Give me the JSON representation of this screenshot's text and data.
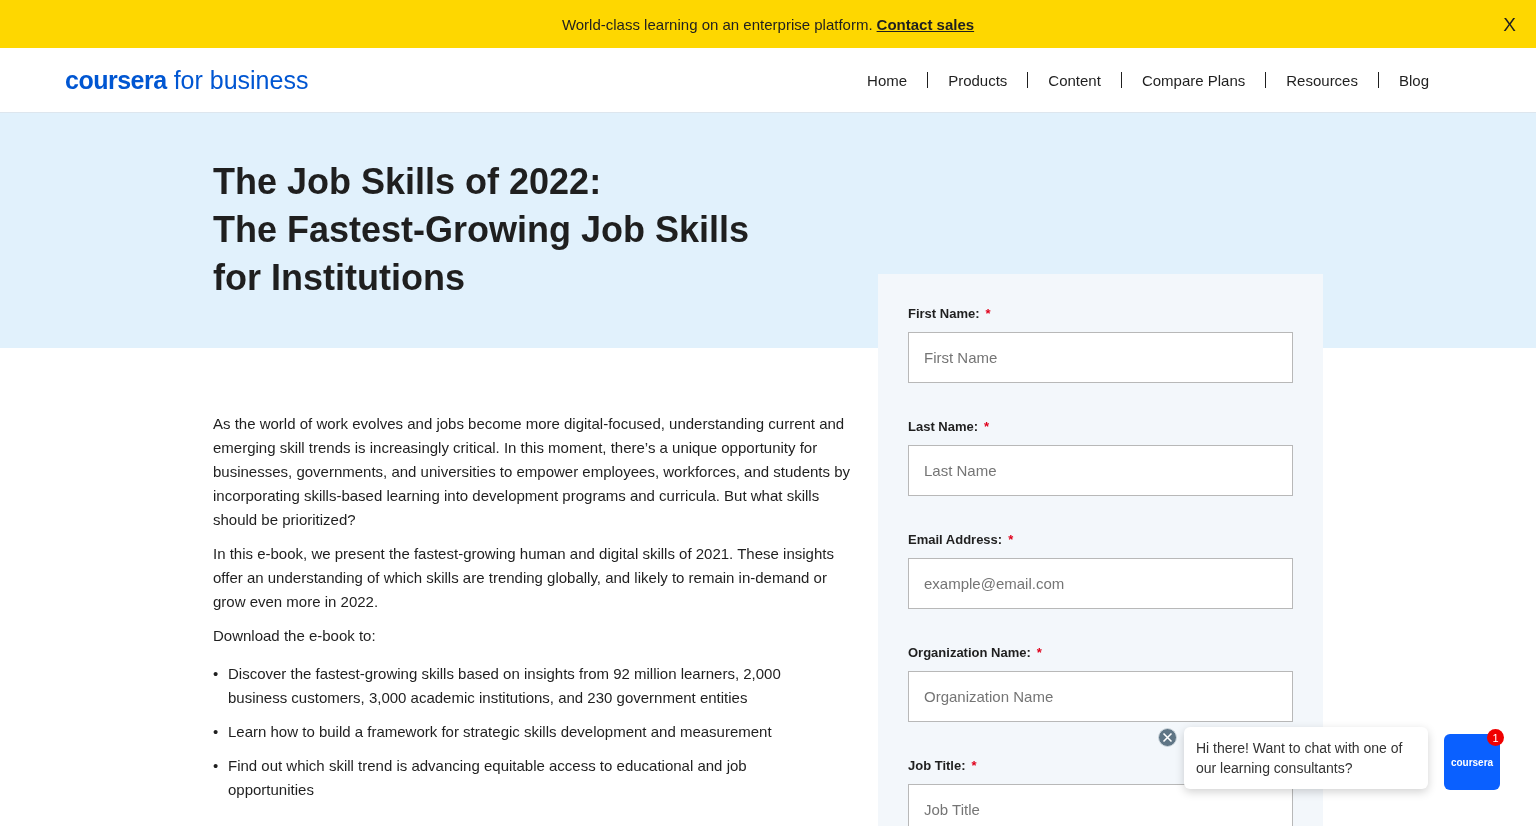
{
  "banner": {
    "text": "World-class learning on an enterprise platform.",
    "link": "Contact sales",
    "close": "X"
  },
  "header": {
    "logo": {
      "brand": "coursera",
      "suffix": "for business"
    },
    "nav": [
      {
        "label": "Home"
      },
      {
        "label": "Products"
      },
      {
        "label": "Content"
      },
      {
        "label": "Compare Plans"
      },
      {
        "label": "Resources"
      },
      {
        "label": "Blog"
      }
    ]
  },
  "hero": {
    "title_lines": [
      "The Job Skills of 2022:",
      "The Fastest-Growing Job Skills for Institutions"
    ]
  },
  "article": {
    "paragraphs": [
      "As the world of work evolves and jobs become more digital-focused, understanding current and emerging skill trends is increasingly critical. In this moment, there’s a unique opportunity for businesses, governments, and universities to empower employees, workforces, and students by incorporating skills-based learning into development programs and curricula. But what skills should be prioritized?",
      "In this e-book, we present the fastest-growing human and digital skills of 2021. These insights offer an understanding of which skills are trending globally, and likely to remain in-demand or grow even more in 2022.",
      "Download the e-book to:"
    ],
    "bullets": [
      {
        "marker": "•",
        "text": "Discover the fastest-growing skills based on insights from 92 million learners, 2,000 business customers, 3,000 academic institutions, and 230 government entities"
      },
      {
        "marker": "•",
        "text": "Learn how to build a framework for strategic skills development and measurement"
      },
      {
        "marker": "•",
        "text": "Find out which skill trend is advancing equitable access to educational and job opportunities"
      }
    ]
  },
  "form": {
    "fields": [
      {
        "label": "First Name:",
        "required_mark": "*",
        "placeholder": "First Name"
      },
      {
        "label": "Last Name:",
        "required_mark": "*",
        "placeholder": "Last Name"
      },
      {
        "label": "Email Address:",
        "required_mark": "*",
        "placeholder": "example@email.com"
      },
      {
        "label": "Organization Name:",
        "required_mark": "*",
        "placeholder": "Organization Name"
      },
      {
        "label": "Job Title:",
        "required_mark": "*",
        "placeholder": "Job Title"
      }
    ]
  },
  "chat": {
    "message": "Hi there! Want to chat with one of our learning consultants?",
    "button_label": "coursera",
    "badge": "1"
  }
}
